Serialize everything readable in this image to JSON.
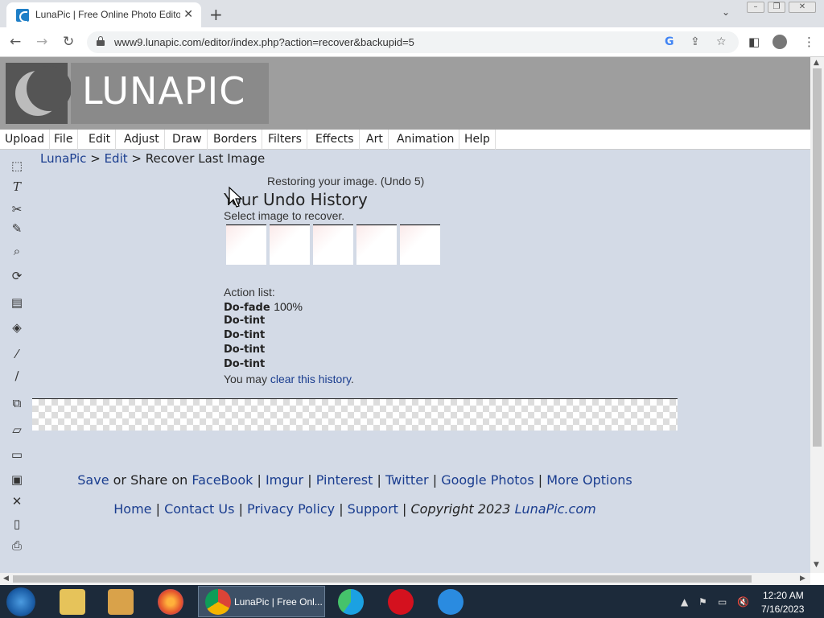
{
  "browser": {
    "tab_title": "LunaPic | Free Online Photo Edito",
    "url": "www9.lunapic.com/editor/index.php?action=recover&backupid=5"
  },
  "logo_text": "LUNAPIC",
  "menu": [
    "Upload",
    "File",
    "Edit",
    "Adjust",
    "Draw",
    "Borders",
    "Filters",
    "Effects",
    "Art",
    "Animation",
    "Help"
  ],
  "breadcrumb": {
    "home": "LunaPic",
    "section": "Edit",
    "current": "Recover Last Image",
    "sep": ">"
  },
  "restore_message": "Restoring your image. (Undo 5)",
  "undo_title": "Your Undo History",
  "select_message": "Select image to recover.",
  "action_label": "Action list:",
  "actions": [
    {
      "name": "Do-fade",
      "value": "100%"
    },
    {
      "name": "Do-tint",
      "value": ""
    },
    {
      "name": "Do-tint",
      "value": ""
    },
    {
      "name": "Do-tint",
      "value": ""
    },
    {
      "name": "Do-tint",
      "value": ""
    }
  ],
  "clear": {
    "prefix": "You may",
    "link": "clear this history",
    "suffix": "."
  },
  "share": {
    "save": "Save",
    "middle": "or Share on",
    "links": [
      "FaceBook",
      "Imgur",
      "Pinterest",
      "Twitter",
      "Google Photos",
      "More Options"
    ],
    "sep": "|"
  },
  "footer": {
    "links": [
      "Home",
      "Contact Us",
      "Privacy Policy",
      "Support"
    ],
    "copyright_prefix": "Copyright 2023",
    "copyright_site": "LunaPic.com"
  },
  "taskbar": {
    "chrome_label": "LunaPic | Free Onl...",
    "time": "12:20 AM",
    "date": "7/16/2023"
  },
  "tools": [
    "select-icon",
    "text-icon",
    "scissors-icon",
    "pencil-icon",
    "zoom-icon",
    "rotate-icon",
    "layer-icon",
    "paint-bucket-icon",
    "eyedropper-icon",
    "brush-icon",
    "crop-icon",
    "eraser-icon",
    "open-folder-icon",
    "save-icon",
    "close-icon",
    "page-icon",
    "print-icon"
  ]
}
